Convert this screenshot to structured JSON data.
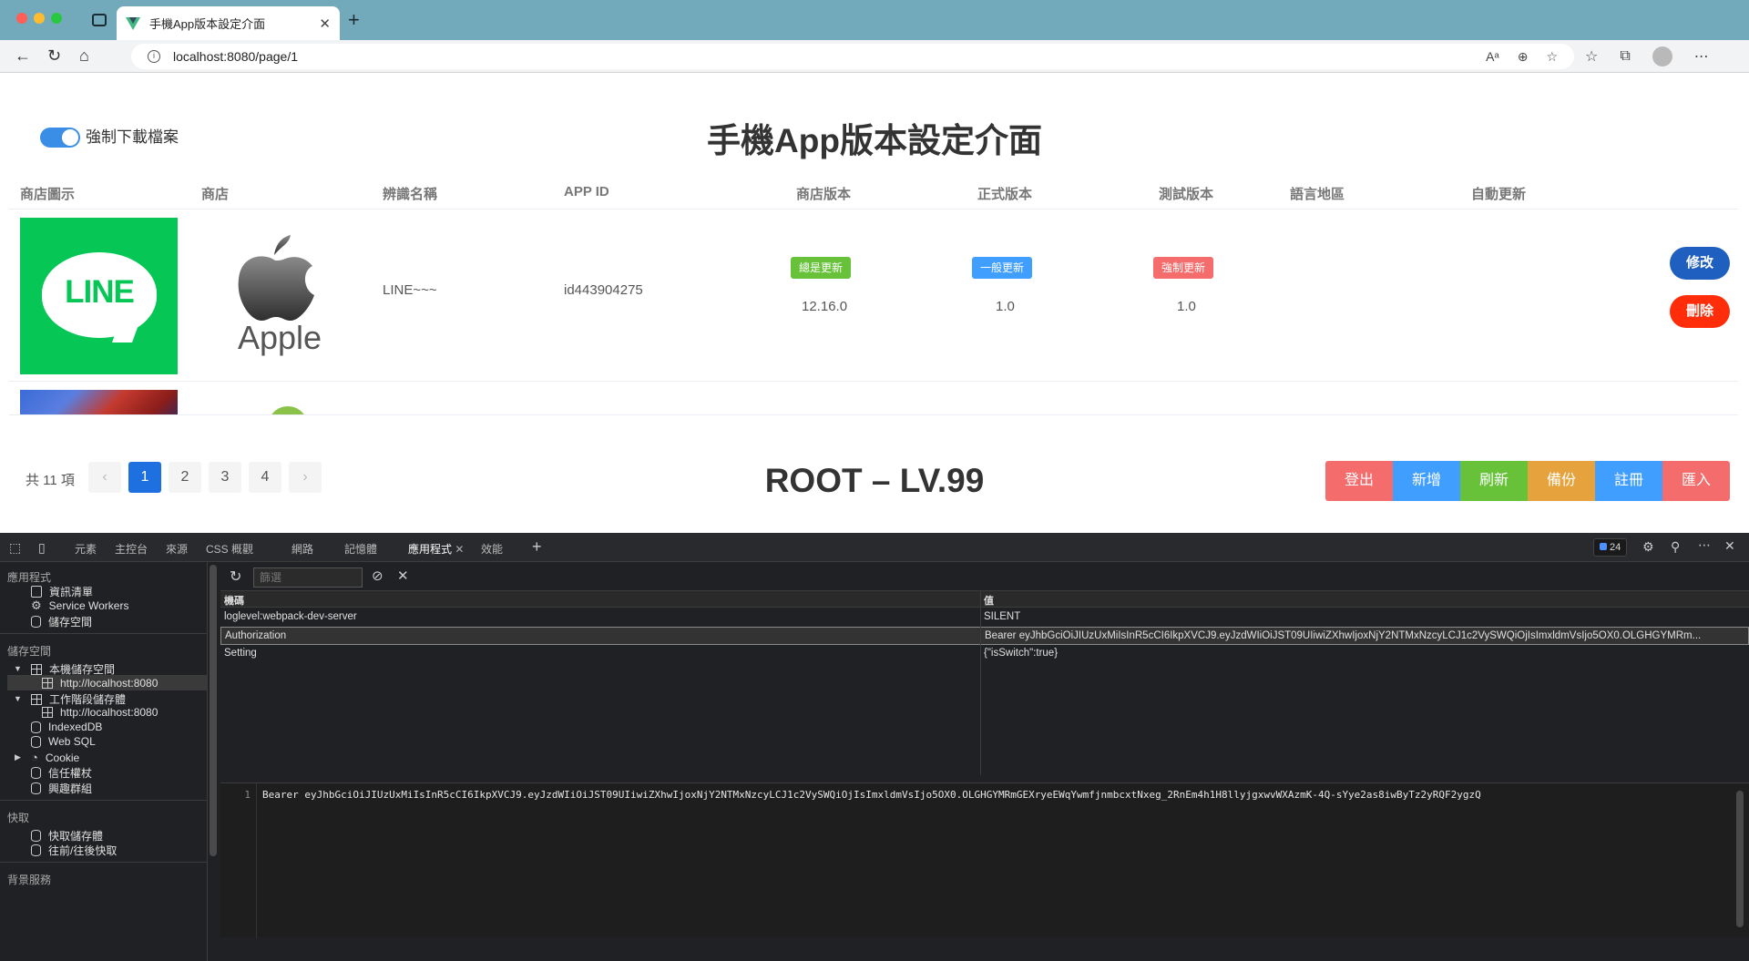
{
  "browser": {
    "tab_title": "手機App版本設定介面",
    "url": "localhost:8080/page/1"
  },
  "page": {
    "force_download_label": "強制下載檔案",
    "force_download_on": true,
    "title": "手機App版本設定介面",
    "columns": [
      "商店圖示",
      "商店",
      "辨識名稱",
      "APP ID",
      "商店版本",
      "正式版本",
      "測試版本",
      "語言地區",
      "自動更新"
    ],
    "row": {
      "logo_text": "LINE",
      "store_text": "Apple",
      "name": "LINE~~~",
      "app_id": "id443904275",
      "store_tag": "總是更新",
      "store_version": "12.16.0",
      "release_tag": "一般更新",
      "release_version": "1.0",
      "test_tag": "強制更新",
      "test_version": "1.0",
      "edit_label": "修改",
      "delete_label": "刪除"
    },
    "pagination": {
      "total": "共 11 項",
      "prev": "‹",
      "next": "›",
      "pages": [
        "1",
        "2",
        "3",
        "4"
      ],
      "current": "1"
    },
    "user_level": "ROOT – LV.99",
    "actions": [
      {
        "label": "登出",
        "color": "#f56c6c"
      },
      {
        "label": "新增",
        "color": "#409eff"
      },
      {
        "label": "刷新",
        "color": "#67c23a"
      },
      {
        "label": "備份",
        "color": "#e6a23c"
      },
      {
        "label": "註冊",
        "color": "#409eff"
      },
      {
        "label": "匯入",
        "color": "#f56c6c"
      }
    ]
  },
  "devtools": {
    "tabs": [
      "元素",
      "主控台",
      "來源",
      "CSS 概觀",
      "網路",
      "記憶體",
      "應用程式",
      "效能"
    ],
    "active_tab": "應用程式",
    "issues_count": "24",
    "sidebar": {
      "section_app": "應用程式",
      "app_items": [
        "資訊清單",
        "Service Workers",
        "儲存空間"
      ],
      "section_storage": "儲存空間",
      "local_storage": "本機儲存空間",
      "local_storage_origin": "http://localhost:8080",
      "session_storage": "工作階段儲存體",
      "session_storage_origin": "http://localhost:8080",
      "indexeddb": "IndexedDB",
      "websql": "Web SQL",
      "cookie": "Cookie",
      "trust_tokens": "信任權杖",
      "interest_groups": "興趣群組",
      "section_cache": "快取",
      "cache_storage": "快取儲存體",
      "bfcache": "往前/往後快取",
      "section_background": "背景服務"
    },
    "filter_placeholder": "篩選",
    "table": {
      "key_header": "機碼",
      "value_header": "值",
      "rows": [
        {
          "key": "loglevel:webpack-dev-server",
          "value": "SILENT"
        },
        {
          "key": "Authorization",
          "value": "Bearer eyJhbGciOiJIUzUxMiIsInR5cCI6IkpXVCJ9.eyJzdWIiOiJST09UIiwiZXhwIjoxNjY2NTMxNzcyLCJ1c2VySWQiOjIsImxldmVsIjo5OX0.OLGHGYMRm..."
        },
        {
          "key": "Setting",
          "value": "{\"isSwitch\":true}"
        }
      ]
    },
    "editor": {
      "line_number": "1",
      "content": "Bearer eyJhbGciOiJIUzUxMiIsInR5cCI6IkpXVCJ9.eyJzdWIiOiJST09UIiwiZXhwIjoxNjY2NTMxNzcyLCJ1c2VySWQiOjIsImxldmVsIjo5OX0.OLGHGYMRmGEXryeEWqYwmfjnmbcxtNxeg_2RnEm4h1H8llyjgxwvWXAzmK-4Q-sYye2as8iwByTz2yRQF2ygzQ"
    }
  }
}
